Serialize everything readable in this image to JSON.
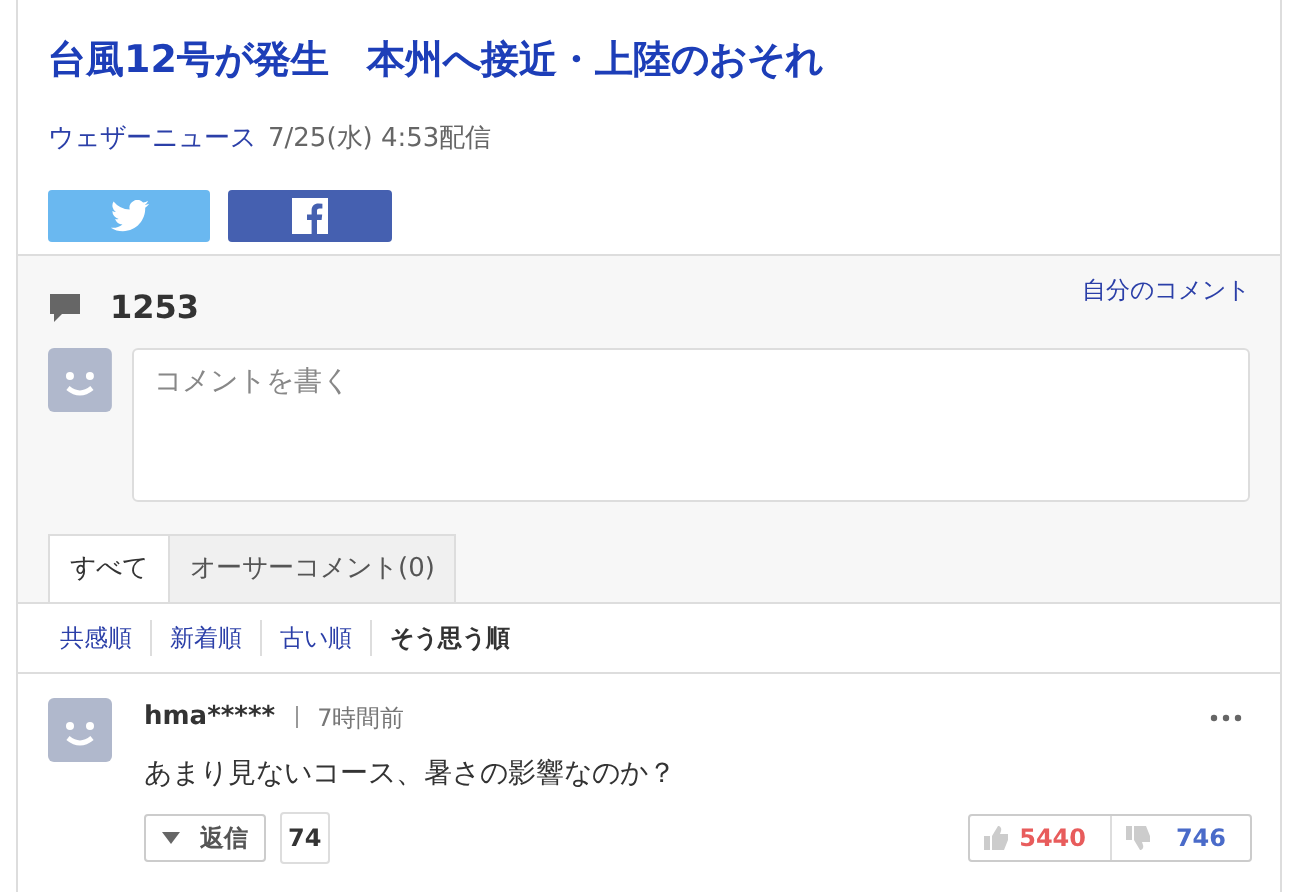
{
  "article": {
    "title": "台風12号が発生　本州へ接近・上陸のおそれ",
    "source": "ウェザーニュース",
    "date": "7/25(水) 4:53配信"
  },
  "share_buttons": [
    {
      "kind": "twitter"
    },
    {
      "kind": "facebook"
    }
  ],
  "comments_header": {
    "count": "1253",
    "my_comments_link": "自分のコメント"
  },
  "comment_form": {
    "placeholder": "コメントを書く"
  },
  "tabs": [
    {
      "label": "すべて",
      "selected": true
    },
    {
      "label": "オーサーコメント(0)",
      "selected": false
    }
  ],
  "sort_options": [
    {
      "label": "共感順",
      "selected": false
    },
    {
      "label": "新着順",
      "selected": false
    },
    {
      "label": "古い順",
      "selected": false
    },
    {
      "label": "そう思う順",
      "selected": true
    }
  ],
  "comments": [
    {
      "user": "hma*****",
      "time": "7時間前",
      "text": "あまり見ないコース、暑さの影響なのか？",
      "reply_label": "返信",
      "reply_count": "74",
      "likes": "5440",
      "dislikes": "746"
    }
  ]
}
